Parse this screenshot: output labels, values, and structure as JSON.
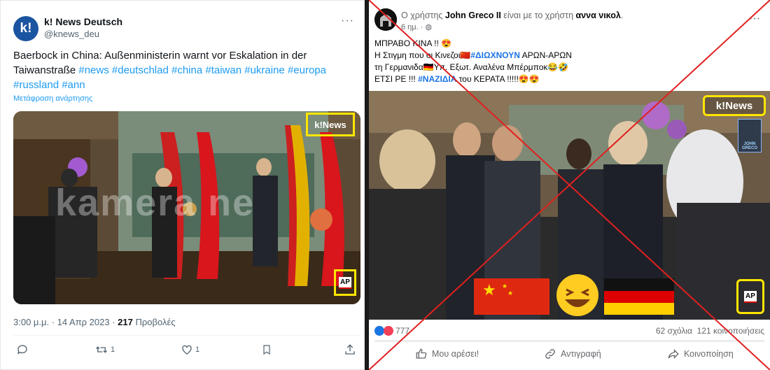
{
  "tweet": {
    "avatar_text": "k!",
    "name": "k! News Deutsch",
    "handle": "@knews_deu",
    "more": "···",
    "text_plain_1": "Baerbock in China: Außenministerin warnt vor Eskalation in der Taiwanstraße ",
    "hashtags": [
      "#news",
      "#deutschlad",
      "#china",
      "#taiwan",
      "#ukraine",
      "#europa",
      "#russland",
      "#ann"
    ],
    "translate": "Μετάφραση ανάρτησης",
    "media": {
      "badge_logo": "k!News",
      "watermark": "kamera ne",
      "ap_logo": "AP"
    },
    "meta_time": "3:00 μ.μ. · 14 Απρ 2023 · ",
    "meta_views_count": "217",
    "meta_views_label": " Προβολές",
    "actions": {
      "reply_icon": "reply-icon",
      "retweet_count": "1",
      "like_count": "1",
      "bookmark_icon": "bookmark-icon",
      "share_icon": "share-icon"
    }
  },
  "fb": {
    "header_prefix": "Ο χρήστης ",
    "author": "John Greco II",
    "header_mid": " είναι με το χρήστη ",
    "tagged": "αννα νικολ",
    "header_suffix": ".",
    "time": "6 ημ. · ",
    "more": "···",
    "text": {
      "line1": "ΜΠΡΑΒΟ ΚΙΝΑ !! 😍",
      "line2_a": "Η Στιγμη που οι Κινεζοι🇨🇳",
      "line2_tag": "#ΔΙΩΧΝΟΥΝ",
      "line2_b": " ΑΡΩΝ-ΑΡΩΝ",
      "line3": "τη Γερμανιδα🇩🇪Υπ. Εξωτ. Αναλένα Μπέρμποκ😂🤣",
      "line4_a": "ΕΤΣΙ ΡΕ !!! ",
      "line4_tag": "#ΝΑΖΙΔΙΑ",
      "line4_b": " του ΚΕΡΑΤΑ !!!!!😍😍"
    },
    "media": {
      "badge_logo": "k!News",
      "greco_logo": "JOHN GRECO",
      "ap_logo": "AP"
    },
    "stats": {
      "reactions": "777",
      "comments": "62 σχόλια",
      "shares": "121 κοινοποιήσεις"
    },
    "actions": {
      "like": "Μου αρέσει!",
      "copy": "Αντιγραφή",
      "share": "Κοινοποίηση"
    }
  },
  "colors": {
    "twitter_blue": "#1d9bf0",
    "fb_blue": "#1b74e4",
    "highlight": "#ffe600",
    "cross": "#e02020"
  }
}
